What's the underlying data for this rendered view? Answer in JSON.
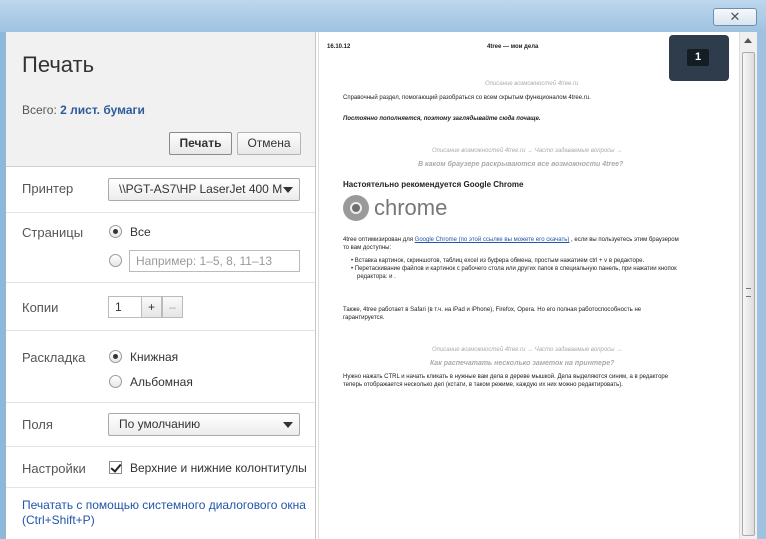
{
  "window": {
    "close_label": "✕"
  },
  "print": {
    "title": "Печать",
    "total_label": "Всего:",
    "total_value": "2 лист. бумаги",
    "print_button": "Печать",
    "cancel_button": "Отмена",
    "printer_label": "Принтер",
    "printer_value": "\\\\PGT-AS7\\HP LaserJet 400 M",
    "pages_label": "Страницы",
    "pages_all": "Все",
    "pages_placeholder": "Например: 1–5, 8, 11–13",
    "copies_label": "Копии",
    "copies_value": "1",
    "copies_plus": "+",
    "copies_minus": "–",
    "layout_label": "Раскладка",
    "layout_portrait": "Книжная",
    "layout_landscape": "Альбомная",
    "margins_label": "Поля",
    "margins_value": "По умолчанию",
    "settings_label": "Настройки",
    "headers_footers": "Верхние и нижние колонтитулы",
    "system_dialog_link": "Печатать с помощью системного диалогового окна (Ctrl+Shift+P)"
  },
  "preview": {
    "page_badge": "1",
    "date": "16.10.12",
    "header_title": "4tree — мои дела",
    "breadcrumb1": "Описание возможностей 4tree.ru",
    "intro": "Справочный раздел, помогающий разобраться со всем скрытым функционалом 4tree.ru.",
    "updated": "Постоянно пополняется, поэтому заглядывайте сюда почаще.",
    "breadcrumb2": "Описание возможностей 4tree.ru → Часто задаваемые вопросы →",
    "q1": "В каком браузере раскрываются все возможности 4tree?",
    "recommend": "Настоятельно рекомендуется Google Chrome",
    "chrome_word": "chrome",
    "opt_line1a": "4tree оптимизирован для",
    "opt_link": "Google Chrome (по этой ссылке вы можете его скачать)",
    "opt_line1b": ", если вы пользуетесь этим браузером",
    "opt_line2": "то вам доступны:",
    "bullet1": "Вставка картинок, скриншотов, таблиц excel из буфера обмена, простым нажатием ctrl + v в редакторе.",
    "bullet2a": "Перетаскивание файлов и картинок с рабочего стола или других папок в специальную панель, при нажатии кнопок",
    "bullet2b": "редактора:   и  .",
    "safari1": "Также, 4tree работает в Safari (в т.ч. на iPad и iPhone), Firefox, Opera. Но его полная работоспособность не",
    "safari2": "гарантируется.",
    "breadcrumb3": "Описание возможностей 4tree.ru → Часто задаваемые вопросы →",
    "q2": "Как распечатать несколько заметок на принтере?",
    "ans1": "Нужно нажать CTRL и начать кликать в нужные вам дела в дереве мышкой. Дела выделяются синим, а в редакторе",
    "ans2": "теперь отображается несколько дел (кстати, в таком режиме, каждую их них можно редактировать)."
  }
}
